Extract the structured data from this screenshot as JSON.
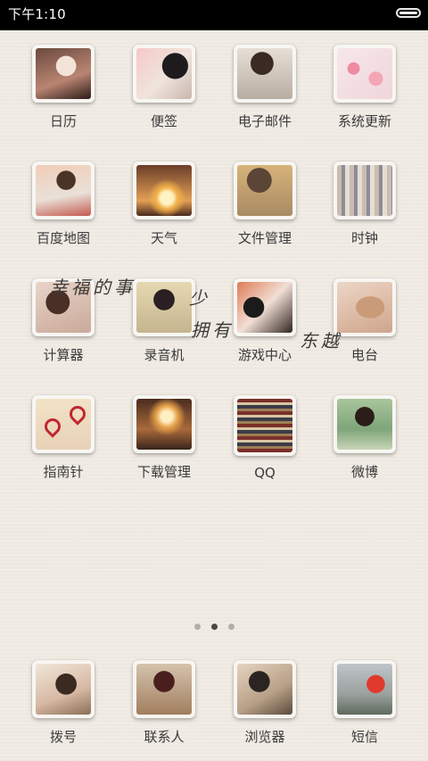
{
  "status_bar": {
    "time": "下午1:10",
    "battery_level": 1.0
  },
  "home": {
    "rows": [
      [
        {
          "label": "日历",
          "icon": "calendar-photo-icon"
        },
        {
          "label": "便签",
          "icon": "notes-photo-icon"
        },
        {
          "label": "电子邮件",
          "icon": "email-photo-icon"
        },
        {
          "label": "系统更新",
          "icon": "system-update-photo-icon"
        }
      ],
      [
        {
          "label": "百度地图",
          "icon": "baidu-map-photo-icon"
        },
        {
          "label": "天气",
          "icon": "weather-photo-icon"
        },
        {
          "label": "文件管理",
          "icon": "file-manager-photo-icon"
        },
        {
          "label": "时钟",
          "icon": "clock-photo-icon"
        }
      ],
      [
        {
          "label": "计算器",
          "icon": "calculator-photo-icon"
        },
        {
          "label": "录音机",
          "icon": "recorder-photo-icon"
        },
        {
          "label": "游戏中心",
          "icon": "game-center-photo-icon"
        },
        {
          "label": "电台",
          "icon": "radio-photo-icon"
        }
      ],
      [
        {
          "label": "指南针",
          "icon": "compass-photo-icon"
        },
        {
          "label": "下载管理",
          "icon": "download-manager-photo-icon"
        },
        {
          "label": "QQ",
          "icon": "qq-photo-icon"
        },
        {
          "label": "微博",
          "icon": "weibo-photo-icon"
        }
      ]
    ],
    "overlay_text": [
      "幸福的事",
      "少",
      "拥有",
      "东越"
    ],
    "page_indicator": {
      "pages": 3,
      "current": 2
    }
  },
  "dock": [
    {
      "label": "拨号",
      "icon": "dialer-photo-icon"
    },
    {
      "label": "联系人",
      "icon": "contacts-photo-icon"
    },
    {
      "label": "浏览器",
      "icon": "browser-photo-icon"
    },
    {
      "label": "短信",
      "icon": "messages-photo-icon"
    }
  ]
}
